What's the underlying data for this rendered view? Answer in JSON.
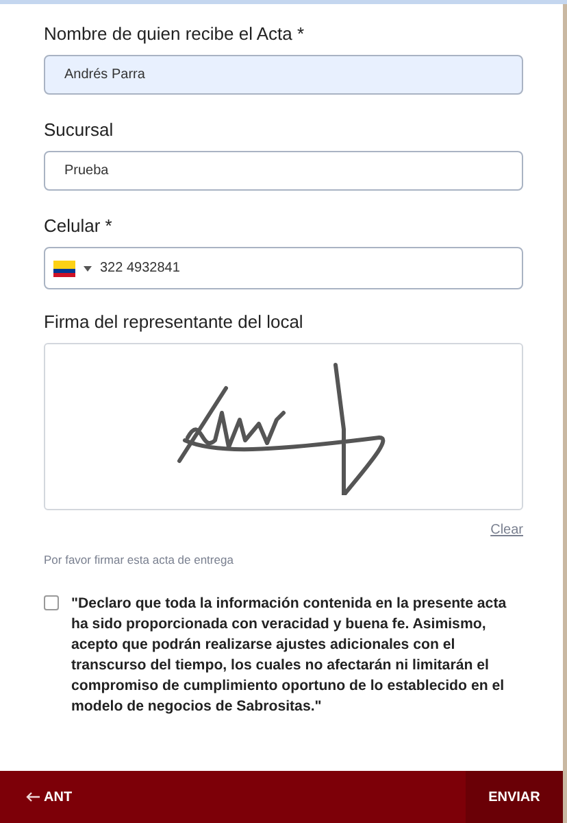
{
  "fields": [
    {
      "kind": "text",
      "label": "Nombre de quien recibe el Acta *",
      "value": "Andrés Parra",
      "autofilled": true
    },
    {
      "kind": "text",
      "label": "Sucursal",
      "value": "Prueba",
      "autofilled": false
    },
    {
      "kind": "phone",
      "label": "Celular *",
      "value": "322 4932841",
      "autofilled": false
    }
  ],
  "signature": {
    "label": "Firma del representante del local",
    "clear": "Clear",
    "hint": "Por favor firmar esta acta de entrega"
  },
  "declaration": {
    "checked": false,
    "text": "\"Declaro que toda la información contenida en la presente acta ha sido proporcionada con veracidad y buena fe. Asimismo, acepto que podrán realizarse ajustes adicionales con el transcurso del tiempo, los cuales no afectarán ni limitarán el compromiso de cumplimiento oportuno de lo establecido en el modelo de negocios de Sabrositas.\""
  },
  "footer": {
    "back": "ANT",
    "submit": "ENVIAR"
  }
}
